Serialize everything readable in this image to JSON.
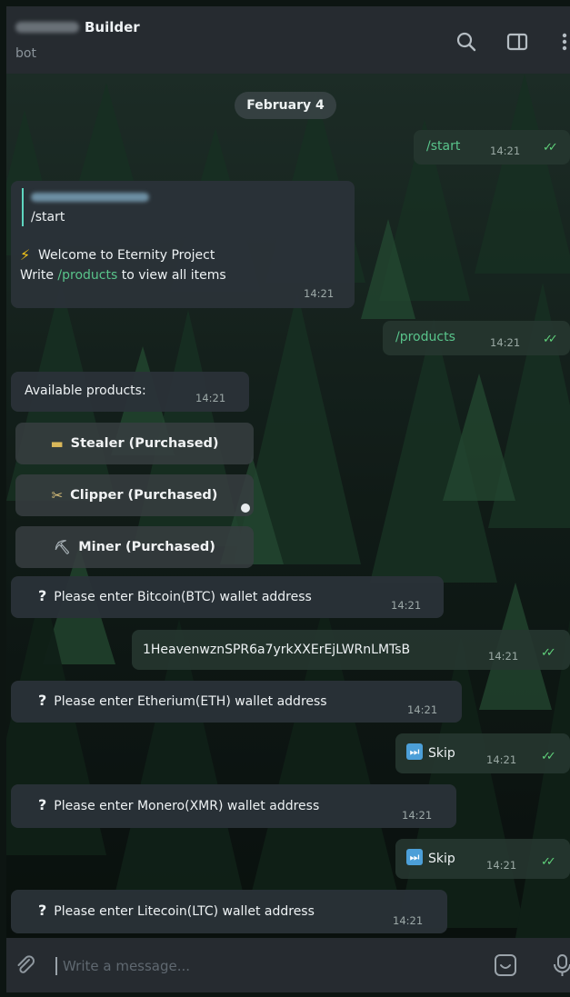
{
  "header": {
    "title": "Builder",
    "subtitle": "bot"
  },
  "date_label": "February 4",
  "messages": {
    "m1": {
      "text": "/start",
      "time": "14:21"
    },
    "m2": {
      "quote": "/start",
      "line1": "Welcome to Eternity Project",
      "line2_a": "Write ",
      "line2_link": "/products",
      "line2_b": " to view all items",
      "time": "14:21",
      "icon": "lightning-emoji"
    },
    "m3": {
      "text": "/products",
      "time": "14:21"
    },
    "m4": {
      "text": "Available products:",
      "time": "14:21"
    },
    "m5": {
      "text": "Please enter Bitcoin(BTC) wallet address",
      "time": "14:21"
    },
    "m6": {
      "text": "1HeavenwznSPR6a7yrkXXErEjLWRnLMTsB",
      "time": "14:21"
    },
    "m7": {
      "text": "Please enter Etherium(ETH) wallet address",
      "time": "14:21"
    },
    "m8": {
      "text": "Skip",
      "time": "14:21"
    },
    "m9": {
      "text": "Please enter Monero(XMR) wallet address",
      "time": "14:21"
    },
    "m10": {
      "text": "Skip",
      "time": "14:21"
    },
    "m11": {
      "text": "Please enter Litecoin(LTC) wallet address",
      "time": "14:21"
    }
  },
  "keyboard": {
    "stealer": "Stealer (Purchased)",
    "clipper": "Clipper (Purchased)",
    "miner": "Miner (Purchased)"
  },
  "composer": {
    "placeholder": "Write a message..."
  },
  "colors": {
    "accent": "#59c48b",
    "ticks": "#5fd07a",
    "header_bg": "#262b30"
  }
}
